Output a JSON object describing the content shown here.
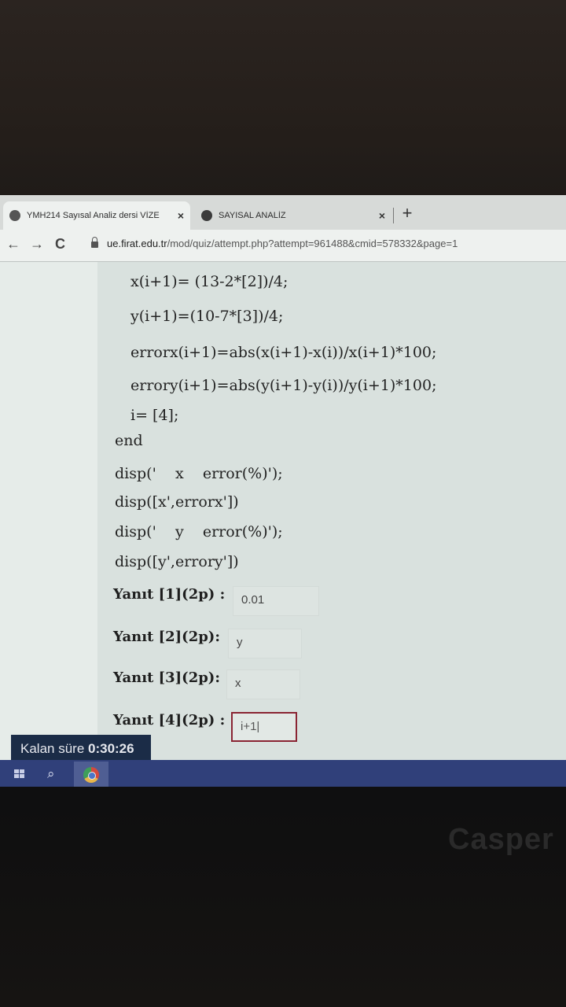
{
  "browser": {
    "tabs": [
      {
        "title": "YMH214 Sayısal Analiz dersi VİZE",
        "close": "×"
      },
      {
        "title": "SAYISAL ANALİZ",
        "close": "×"
      }
    ],
    "new_tab": "+",
    "nav": {
      "back": "←",
      "forward": "→",
      "reload": "C"
    },
    "url_host": "ue.firat.edu.tr",
    "url_path": "/mod/quiz/attempt.php?attempt=961488&cmid=578332&page=1"
  },
  "code_lines": [
    "x(i+1)= (13-2*[2])/4;",
    "y(i+1)=(10-7*[3])/4;",
    "errorx(i+1)=abs(x(i+1)-x(i))/x(i+1)*100;",
    "errory(i+1)=abs(y(i+1)-y(i))/y(i+1)*100;",
    "i= [4];",
    "end",
    "disp('    x    error(%)');",
    "disp([x',errorx'])",
    "disp('    y    error(%)');",
    "disp([y',errory'])"
  ],
  "answers": [
    {
      "label": "Yanıt [1](2p) :",
      "value": "0.01"
    },
    {
      "label": "Yanıt [2](2p):",
      "value": "y"
    },
    {
      "label": "Yanıt [3](2p):",
      "value": "x"
    },
    {
      "label": "Yanıt [4](2p) :",
      "value": "i+1|"
    }
  ],
  "timer": {
    "label": "Kalan süre",
    "value": "0:30:26"
  },
  "taskbar": {
    "search_icon": "⌕"
  },
  "brand": "Casper"
}
